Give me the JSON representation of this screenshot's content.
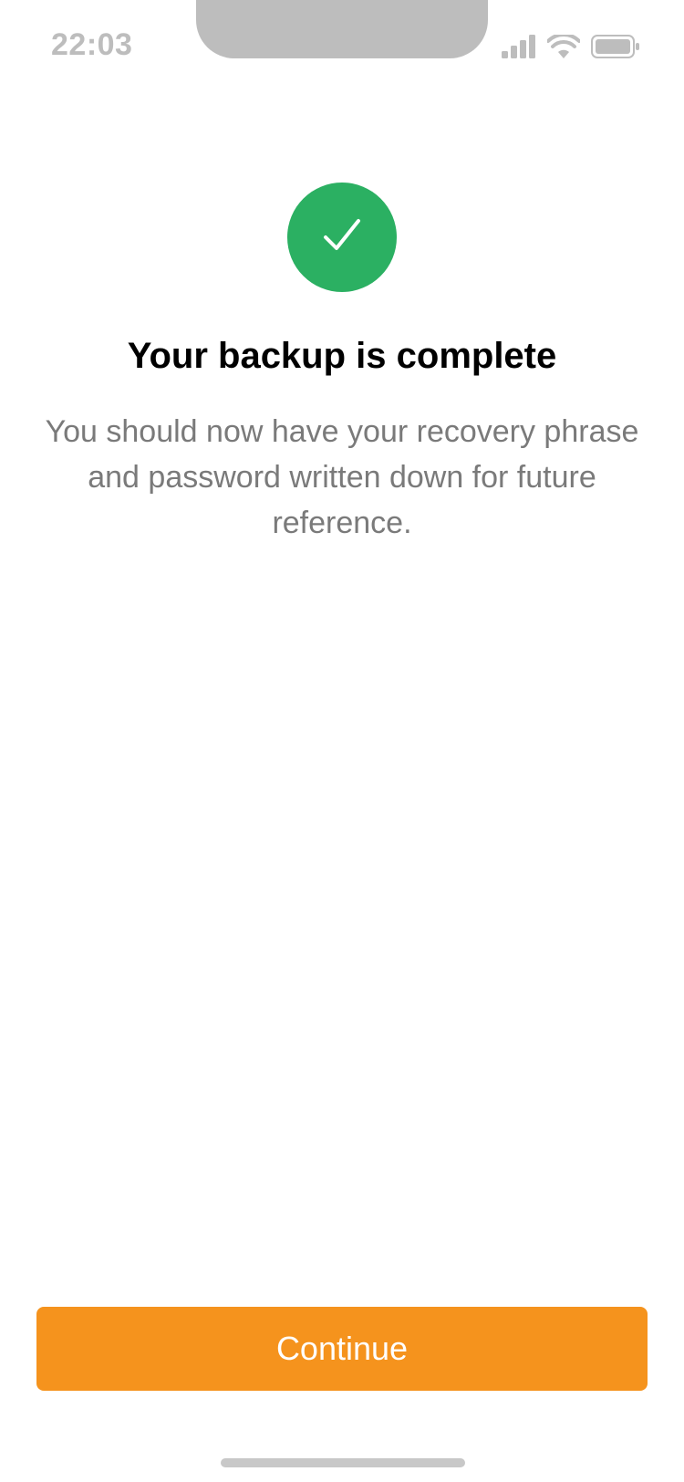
{
  "status_bar": {
    "time": "22:03",
    "icons": [
      "signal-icon",
      "wifi-icon",
      "battery-icon"
    ],
    "color": "#bdbdbd"
  },
  "success": {
    "icon": "checkmark-icon",
    "badge_color": "#2bb062"
  },
  "title": "Your backup is complete",
  "description": "You should now have your recovery phrase and password written down for future reference.",
  "continue_button": {
    "label": "Continue",
    "color": "#f5931d"
  }
}
